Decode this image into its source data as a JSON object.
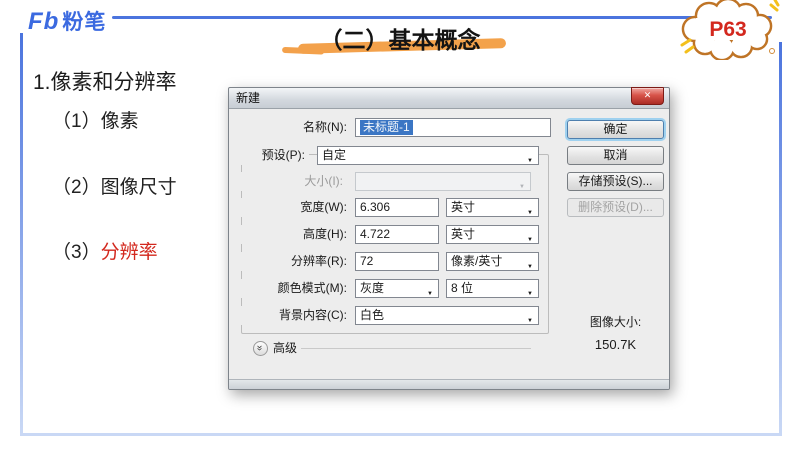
{
  "header": {
    "logo_fb": "Fb",
    "logo_cn": "粉笔",
    "title": "（二）基本概念",
    "badge": "P63"
  },
  "outline": {
    "heading": "1.像素和分辨率",
    "items": [
      {
        "prefix": "（1）",
        "text": "像素"
      },
      {
        "prefix": "（2）",
        "text": "图像尺寸"
      },
      {
        "prefix": "（3）",
        "text": "分辨率"
      }
    ]
  },
  "dialog": {
    "title": "新建",
    "fields": {
      "name": {
        "label": "名称(N):",
        "value": "未标题-1"
      },
      "preset": {
        "label": "预设(P):",
        "value": "自定"
      },
      "size": {
        "label": "大小(I):",
        "value": ""
      },
      "width": {
        "label": "宽度(W):",
        "value": "6.306",
        "unit": "英寸"
      },
      "height": {
        "label": "高度(H):",
        "value": "4.722",
        "unit": "英寸"
      },
      "resolution": {
        "label": "分辨率(R):",
        "value": "72",
        "unit": "像素/英寸"
      },
      "color_mode": {
        "label": "颜色模式(M):",
        "value": "灰度",
        "depth": "8 位"
      },
      "background": {
        "label": "背景内容(C):",
        "value": "白色"
      }
    },
    "advanced": {
      "label": "高级"
    },
    "buttons": {
      "ok": "确定",
      "cancel": "取消",
      "save_preset": "存储预设(S)...",
      "delete_preset": "删除预设(D)..."
    },
    "image_size": {
      "label": "图像大小:",
      "value": "150.7K"
    }
  },
  "icons": {
    "dropdown_arrow": "▼",
    "close": "✕",
    "advanced_chevrons": "»"
  },
  "colors": {
    "accent_blue": "#4b74de",
    "badge_red": "#d3281e",
    "term_red": "#d3281e",
    "highlight_orange": "#f29a3c",
    "selection_blue": "#3b76c4"
  }
}
